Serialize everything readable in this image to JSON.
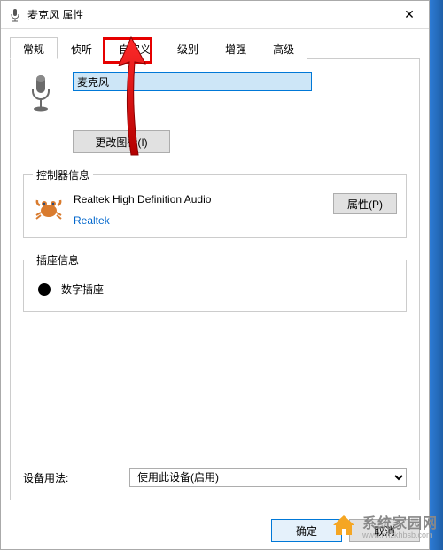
{
  "titlebar": {
    "title": "麦克风 属性",
    "close": "✕"
  },
  "tabs": {
    "general": "常规",
    "listen": "侦听",
    "custom": "自定义",
    "levels": "级别",
    "enhance": "增强",
    "advanced": "高级"
  },
  "device": {
    "name_value": "麦克风",
    "change_icon_btn": "更改图标(I)"
  },
  "controller": {
    "legend": "控制器信息",
    "name": "Realtek High Definition Audio",
    "vendor": "Realtek",
    "properties_btn": "属性(P)"
  },
  "jack": {
    "legend": "插座信息",
    "label": "数字插座"
  },
  "usage": {
    "label": "设备用法:",
    "selected": "使用此设备(启用)"
  },
  "buttons": {
    "ok": "确定",
    "cancel": "取消"
  },
  "watermark": {
    "text": "系统家园网",
    "url": "www.hnzkhbsb.com"
  }
}
